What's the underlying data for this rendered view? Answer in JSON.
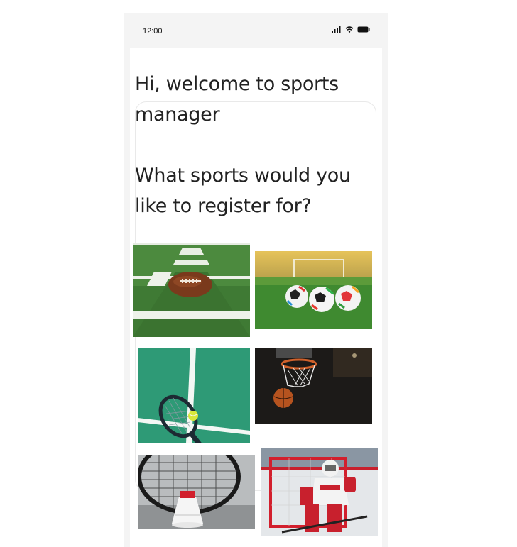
{
  "status_bar": {
    "time": "12:00"
  },
  "greeting": {
    "text": "Hi, welcome to sports\nmanager\n\nWhat sports would you\nlike to register for?"
  },
  "sports": [
    {
      "icon": "american-football"
    },
    {
      "icon": "soccer"
    },
    {
      "icon": "tennis"
    },
    {
      "icon": "basketball"
    },
    {
      "icon": "badminton"
    },
    {
      "icon": "ice-hockey"
    }
  ]
}
